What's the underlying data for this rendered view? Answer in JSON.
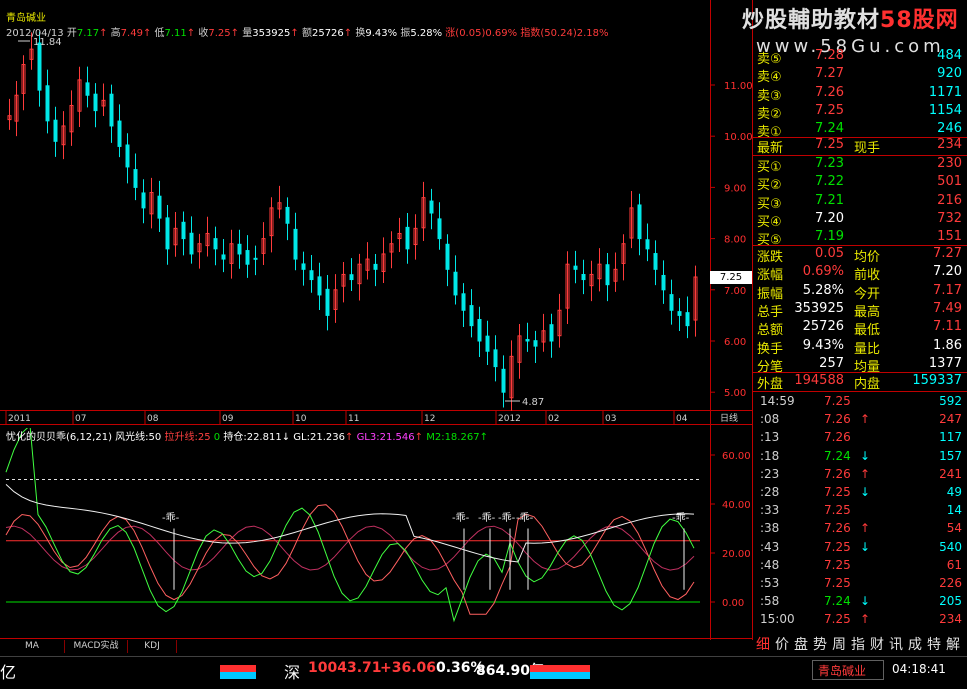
{
  "header": {
    "stock_name": "青岛碱业",
    "date": "2012/04/13",
    "open_label": "开",
    "open": "7.17",
    "high_label": "高",
    "high": "7.49",
    "low_label": "低",
    "low": "7.11",
    "close_label": "收",
    "close": "7.25",
    "vol_label": "量",
    "vol": "353925",
    "amt_label": "额",
    "amt": "25726",
    "turn_label": "换",
    "turn": "9.43%",
    "amp_label": "振",
    "amp": "5.28%",
    "chg_label": "涨",
    "chg": "(0.05)0.69%",
    "idx_label": "指数",
    "idx": "(50.24)2.18%"
  },
  "watermark": {
    "title_a": "炒股輔助教材",
    "title_b": "58股网",
    "url": "www.58Gu.com"
  },
  "main_chart": {
    "y_ticks": [
      "11.00",
      "10.00",
      "9.00",
      "8.00",
      "7.00",
      "6.00",
      "5.00"
    ],
    "x_ticks": [
      "2011",
      "07",
      "08",
      "09",
      "10",
      "11",
      "12",
      "2012",
      "02",
      "03",
      "04"
    ],
    "period": "日线",
    "max_label": "11.84",
    "min_label": "4.87",
    "last_price_tag": "7.25"
  },
  "indicator": {
    "name": "忧化的贝贝乖(6,12,21)",
    "p1_label": "风光线:",
    "p1": "50",
    "p2_label": "拉升线:",
    "p2": "25",
    "p3": "0",
    "p4_label": "持仓:",
    "p4": "22.811",
    "p5_label": "GL:",
    "p5": "21.236",
    "p6_label": "GL3:",
    "p6": "21.546",
    "p7_label": "M2:",
    "p7": "18.267",
    "y_ticks": [
      "60.00",
      "40.00",
      "20.00",
      "0.00"
    ],
    "guai": "乖"
  },
  "order_book": {
    "asks": [
      {
        "label": "卖⑤",
        "price": "7.28",
        "vol": "484"
      },
      {
        "label": "卖④",
        "price": "7.27",
        "vol": "920"
      },
      {
        "label": "卖③",
        "price": "7.26",
        "vol": "1171"
      },
      {
        "label": "卖②",
        "price": "7.25",
        "vol": "1154"
      },
      {
        "label": "卖①",
        "price": "7.24",
        "vol": "246"
      }
    ],
    "last": {
      "label": "最新",
      "price": "7.25",
      "label2": "现手",
      "vol": "234"
    },
    "bids": [
      {
        "label": "买①",
        "price": "7.23",
        "vol": "230"
      },
      {
        "label": "买②",
        "price": "7.22",
        "vol": "501"
      },
      {
        "label": "买③",
        "price": "7.21",
        "vol": "216"
      },
      {
        "label": "买④",
        "price": "7.20",
        "vol": "732"
      },
      {
        "label": "买⑤",
        "price": "7.19",
        "vol": "151"
      }
    ]
  },
  "stats": [
    {
      "l1": "涨跌",
      "v1": "0.05",
      "l2": "均价",
      "v2": "7.27"
    },
    {
      "l1": "涨幅",
      "v1": "0.69%",
      "l2": "前收",
      "v2": "7.20"
    },
    {
      "l1": "振幅",
      "v1": "5.28%",
      "l2": "今开",
      "v2": "7.17"
    },
    {
      "l1": "总手",
      "v1": "353925",
      "l2": "最高",
      "v2": "7.49"
    },
    {
      "l1": "总额",
      "v1": "25726",
      "l2": "最低",
      "v2": "7.11"
    },
    {
      "l1": "换手",
      "v1": "9.43%",
      "l2": "量比",
      "v2": "1.86"
    },
    {
      "l1": "分笔",
      "v1": "257",
      "l2": "均量",
      "v2": "1377"
    }
  ],
  "outer_inner": {
    "l1": "外盘",
    "v1": "194588",
    "l2": "内盘",
    "v2": "159337"
  },
  "ticks": [
    {
      "time": "14:59",
      "price": "7.25",
      "arrow": "",
      "vol": "592"
    },
    {
      "time": ":08",
      "price": "7.26",
      "arrow": "↑",
      "vol": "247"
    },
    {
      "time": ":13",
      "price": "7.26",
      "arrow": "",
      "vol": "117"
    },
    {
      "time": ":18",
      "price": "7.24",
      "arrow": "↓",
      "vol": "157"
    },
    {
      "time": ":23",
      "price": "7.26",
      "arrow": "↑",
      "vol": "241"
    },
    {
      "time": ":28",
      "price": "7.25",
      "arrow": "↓",
      "vol": "49"
    },
    {
      "time": ":33",
      "price": "7.25",
      "arrow": "",
      "vol": "14"
    },
    {
      "time": ":38",
      "price": "7.26",
      "arrow": "↑",
      "vol": "54"
    },
    {
      "time": ":43",
      "price": "7.25",
      "arrow": "↓",
      "vol": "540"
    },
    {
      "time": ":48",
      "price": "7.25",
      "arrow": "",
      "vol": "61"
    },
    {
      "time": ":53",
      "price": "7.25",
      "arrow": "",
      "vol": "226"
    },
    {
      "time": ":58",
      "price": "7.24",
      "arrow": "↓",
      "vol": "205"
    },
    {
      "time": "15:00",
      "price": "7.25",
      "arrow": "↑",
      "vol": "234"
    }
  ],
  "func_bar": [
    "细",
    "价",
    "盘",
    "势",
    "周",
    "指",
    "财",
    "讯",
    "成",
    "特",
    "解"
  ],
  "bottom_tabs": [
    "MA",
    "MACD实战",
    "KDJ"
  ],
  "status": {
    "left_char": "亿",
    "mkt": "深",
    "index": "10043.71",
    "chg": "+36.06",
    "pct": "0.36%",
    "amount": "864.90亿",
    "stock": "青岛碱业",
    "time": "04:18:41"
  },
  "colors": {
    "up": "#ff3b3b",
    "down": "#00e000",
    "grid": "#c00000"
  }
}
